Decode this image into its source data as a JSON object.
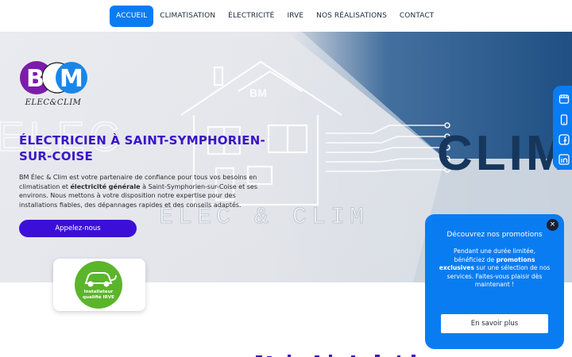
{
  "nav": {
    "items": [
      {
        "label": "ACCUEIL",
        "active": true
      },
      {
        "label": "CLIMATISATION",
        "active": false
      },
      {
        "label": "ÉLECTRICITÉ",
        "active": false
      },
      {
        "label": "IRVE",
        "active": false
      },
      {
        "label": "NOS RÉALISATIONS",
        "active": false
      },
      {
        "label": "CONTACT",
        "active": false
      }
    ]
  },
  "logo": {
    "monogram": "BM",
    "tagline": "ELEC&CLIM"
  },
  "hero": {
    "title": "ÉLECTRICIEN À SAINT-SYMPHORIEN-SUR-COISE",
    "desc_part1": "BM Élec & Clim est votre partenaire de confiance pour tous vos besoins en climatisation et ",
    "desc_bold": "électricité générale",
    "desc_part2": " à Saint-Symphorien-sur-Coise et ses environs. Nous mettons à votre disposition notre expertise pour des installations fiables, des dépannages rapides et des conseils adaptés.",
    "cta_label": "Appelez-nous",
    "art_big_left": "ELEC",
    "art_big_right": "CLIM",
    "art_house_mark": "BM",
    "art_brand_line": "ELEC & CLIM"
  },
  "badge": {
    "label_line1": "Installateur",
    "label_line2": "qualifié IRVE"
  },
  "social": {
    "icons": [
      "store-icon",
      "phone-icon",
      "facebook-icon",
      "linkedin-icon"
    ]
  },
  "promo": {
    "close_glyph": "×",
    "title": "Découvrez nos promotions",
    "body_part1": "Pendant une durée limitée, bénéficiez de ",
    "body_bold": "promotions exclusives",
    "body_part2": " sur une sélection de nos services. Faites-vous plaisir dès maintenant !",
    "cta_label": "En savoir plus"
  },
  "colors": {
    "accent": "#0a7cf2",
    "title_purple": "#3a14c8",
    "cta_purple": "#3c0fd8",
    "badge_green": "#5bb52a"
  }
}
